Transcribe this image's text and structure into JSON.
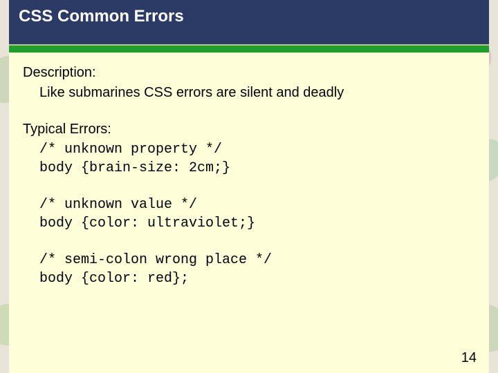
{
  "title": "CSS Common Errors",
  "description": {
    "label": "Description:",
    "text": "Like submarines CSS errors are silent and deadly"
  },
  "errors": {
    "label": "Typical Errors:",
    "items": [
      {
        "comment": "/* unknown property */",
        "code": "body {brain-size: 2cm;}"
      },
      {
        "comment": "/* unknown value */",
        "code": "body {color: ultraviolet;}"
      },
      {
        "comment": "/* semi-colon wrong place */",
        "code": "body {color: red};"
      }
    ]
  },
  "page_number": "14"
}
